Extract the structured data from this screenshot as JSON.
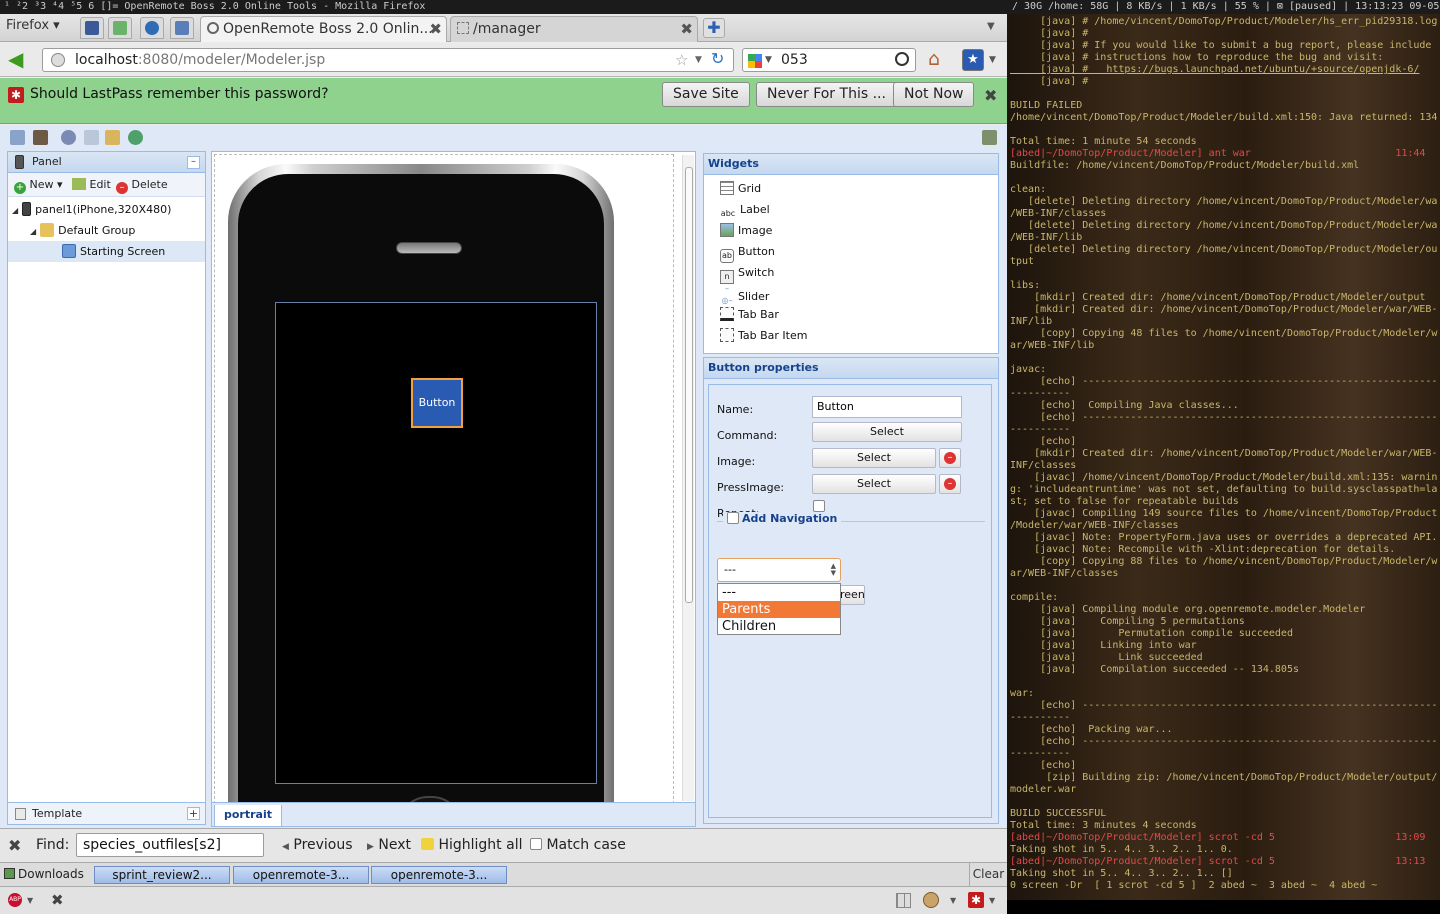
{
  "wm": {
    "left": "¹ ²2 ³3 ⁴4 ⁵5  6  []=  OpenRemote Boss 2.0 Online Tools - Mozilla Firefox",
    "right": "/ 30G /home: 58G | 8 KB/s | 1 KB/s | 55 % | ⊠ [paused] | 13:13:23 09-05"
  },
  "browser": {
    "menu_label": "Firefox",
    "tabs": [
      {
        "label": "OpenRemote Boss 2.0 Onlin..."
      },
      {
        "label": "/manager"
      }
    ],
    "url_host": "localhost",
    "url_path": ":8080/modeler/Modeler.jsp",
    "search_value": "053"
  },
  "notification": {
    "message": "Should LastPass remember this password?",
    "buttons": [
      "Save Site",
      "Never For This ...",
      "Not Now"
    ]
  },
  "left_panel": {
    "title": "Panel",
    "toolbar": [
      "New",
      "Edit",
      "Delete"
    ],
    "tree": [
      {
        "label": "panel1(iPhone,320X480)"
      },
      {
        "label": "Default Group"
      },
      {
        "label": "Starting Screen"
      }
    ],
    "template_label": "Template"
  },
  "canvas": {
    "button_label": "Button",
    "tab_label": "portrait"
  },
  "widgets": {
    "title": "Widgets",
    "items": [
      {
        "label": "Grid",
        "icon": "grid-icon"
      },
      {
        "label": "Label",
        "icon": "label-icon"
      },
      {
        "label": "Image",
        "icon": "image-icon"
      },
      {
        "label": "Button",
        "icon": "button-icon"
      },
      {
        "label": "Switch",
        "icon": "switch-icon"
      },
      {
        "label": "Slider",
        "icon": "slider-icon"
      },
      {
        "label": "Tab Bar",
        "icon": "tabbar-icon"
      },
      {
        "label": "Tab Bar Item",
        "icon": "tabbaritem-icon"
      }
    ]
  },
  "props": {
    "title": "Button properties",
    "name_label": "Name:",
    "name_value": "Button",
    "command_label": "Command:",
    "image_label": "Image:",
    "pressimage_label": "PressImage:",
    "repeat_label": "Repeat:",
    "select_label": "Select",
    "nav_label": "Add Navigation",
    "nav_selected": "---",
    "nav_options": [
      "---",
      "Parents",
      "Children"
    ],
    "screen_btn_label": "reen"
  },
  "findbar": {
    "label": "Find:",
    "value": "species_outfiles[s2]",
    "previous": "Previous",
    "next": "Next",
    "highlight": "Highlight all",
    "matchcase": "Match case"
  },
  "downloads": {
    "label": "Downloads",
    "items": [
      "sprint_review2...",
      "openremote-3...",
      "openremote-3..."
    ],
    "clear": "Clear"
  },
  "terminal": {
    "lines": [
      "     [java] # /home/vincent/DomoTop/Product/Modeler/hs_err_pid29318.log",
      "     [java] #",
      "     [java] # If you would like to submit a bug report, please include",
      "     [java] # instructions how to reproduce the bug and visit:",
      "     [java] #   https://bugs.launchpad.net/ubuntu/+source/openjdk-6/",
      "     [java] #",
      "",
      "BUILD FAILED",
      "/home/vincent/DomoTop/Product/Modeler/build.xml:150: Java returned: 134",
      "",
      "Total time: 1 minute 54 seconds",
      "[abed|~/DomoTop/Product/Modeler] ant war                        11:44",
      "Buildfile: /home/vincent/DomoTop/Product/Modeler/build.xml",
      "",
      "clean:",
      "   [delete] Deleting directory /home/vincent/DomoTop/Product/Modeler/war",
      "/WEB-INF/classes",
      "   [delete] Deleting directory /home/vincent/DomoTop/Product/Modeler/war",
      "/WEB-INF/lib",
      "   [delete] Deleting directory /home/vincent/DomoTop/Product/Modeler/out",
      "tput",
      "",
      "libs:",
      "    [mkdir] Created dir: /home/vincent/DomoTop/Product/Modeler/output",
      "    [mkdir] Created dir: /home/vincent/DomoTop/Product/Modeler/war/WEB-",
      "INF/lib",
      "     [copy] Copying 48 files to /home/vincent/DomoTop/Product/Modeler/w",
      "ar/WEB-INF/lib",
      "",
      "javac:",
      "     [echo] ------------------------------------------------------------",
      "----------",
      "     [echo]  Compiling Java classes...",
      "     [echo] ------------------------------------------------------------",
      "----------",
      "     [echo]",
      "    [mkdir] Created dir: /home/vincent/DomoTop/Product/Modeler/war/WEB-",
      "INF/classes",
      "    [javac] /home/vincent/DomoTop/Product/Modeler/build.xml:135: warnin",
      "g: 'includeantruntime' was not set, defaulting to build.sysclasspath=la",
      "st; set to false for repeatable builds",
      "    [javac] Compiling 149 source files to /home/vincent/DomoTop/Product",
      "/Modeler/war/WEB-INF/classes",
      "    [javac] Note: PropertyForm.java uses or overrides a deprecated API.",
      "    [javac] Note: Recompile with -Xlint:deprecation for details.",
      "     [copy] Copying 88 files to /home/vincent/DomoTop/Product/Modeler/w",
      "ar/WEB-INF/classes",
      "",
      "compile:",
      "     [java] Compiling module org.openremote.modeler.Modeler",
      "     [java]    Compiling 5 permutations",
      "     [java]       Permutation compile succeeded",
      "     [java]    Linking into war",
      "     [java]       Link succeeded",
      "     [java]    Compilation succeeded -- 134.805s",
      "",
      "war:",
      "     [echo] ------------------------------------------------------------",
      "----------",
      "     [echo]  Packing war...",
      "     [echo] ------------------------------------------------------------",
      "----------",
      "     [echo]",
      "      [zip] Building zip: /home/vincent/DomoTop/Product/Modeler/output/",
      "modeler.war",
      "",
      "BUILD SUCCESSFUL",
      "Total time: 3 minutes 4 seconds",
      "[abed|~/DomoTop/Product/Modeler] scrot -cd 5                    13:09",
      "Taking shot in 5.. 4.. 3.. 2.. 1.. 0.",
      "[abed|~/DomoTop/Product/Modeler] scrot -cd 5                    13:13",
      "Taking shot in 5.. 4.. 3.. 2.. 1.. []",
      "0 screen -Dr  [ 1 scrot -cd 5 ]  2 abed ~  3 abed ~  4 abed ~"
    ]
  }
}
